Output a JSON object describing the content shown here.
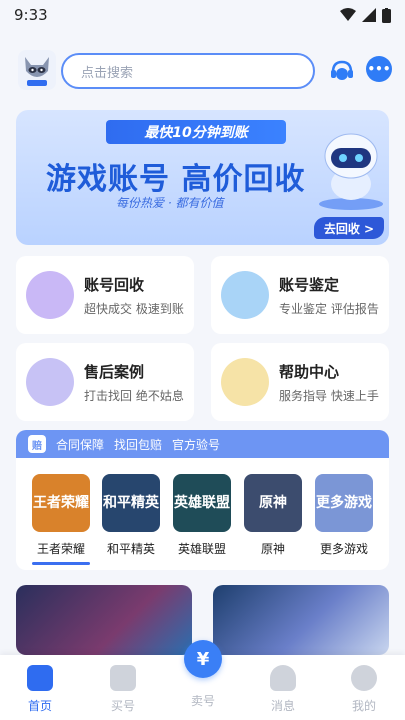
{
  "status": {
    "time": "9:33"
  },
  "header": {
    "search_placeholder": "点击搜索",
    "logo_label": "查号鸭"
  },
  "banner": {
    "ribbon": "最快10分钟到账",
    "title": "游戏账号  高价回收",
    "subtitle": "每份热爱 · 都有价值",
    "button": "去回收 >"
  },
  "services": [
    {
      "title": "账号回收",
      "subtitle": "超快成交 极速到账",
      "color": "#c9b8f6"
    },
    {
      "title": "账号鉴定",
      "subtitle": "专业鉴定 评估报告",
      "color": "#a9d4f7"
    },
    {
      "title": "售后案例",
      "subtitle": "打击找回 绝不姑息",
      "color": "#c7c2f5"
    },
    {
      "title": "帮助中心",
      "subtitle": "服务指导 快速上手",
      "color": "#f6e3a7"
    }
  ],
  "guarantee": {
    "badge": "赔",
    "items": [
      "合同保障",
      "找回包赔",
      "官方验号"
    ]
  },
  "games": [
    {
      "tile": "王者荣耀",
      "name": "王者荣耀",
      "color": "#d9822b"
    },
    {
      "tile": "和平精英",
      "name": "和平精英",
      "color": "#27466e"
    },
    {
      "tile": "英雄联盟",
      "name": "英雄联盟",
      "color": "#1f4c58"
    },
    {
      "tile": "原神",
      "name": "原神",
      "color": "#3c4c6e"
    },
    {
      "tile": "更多游戏",
      "name": "更多游戏",
      "color": "#7b96d6"
    }
  ],
  "tabbar": {
    "items": [
      "首页",
      "买号",
      "卖号",
      "消息",
      "我的"
    ],
    "sell_symbol": "¥"
  },
  "colors": {
    "accent": "#2f6cf0"
  }
}
